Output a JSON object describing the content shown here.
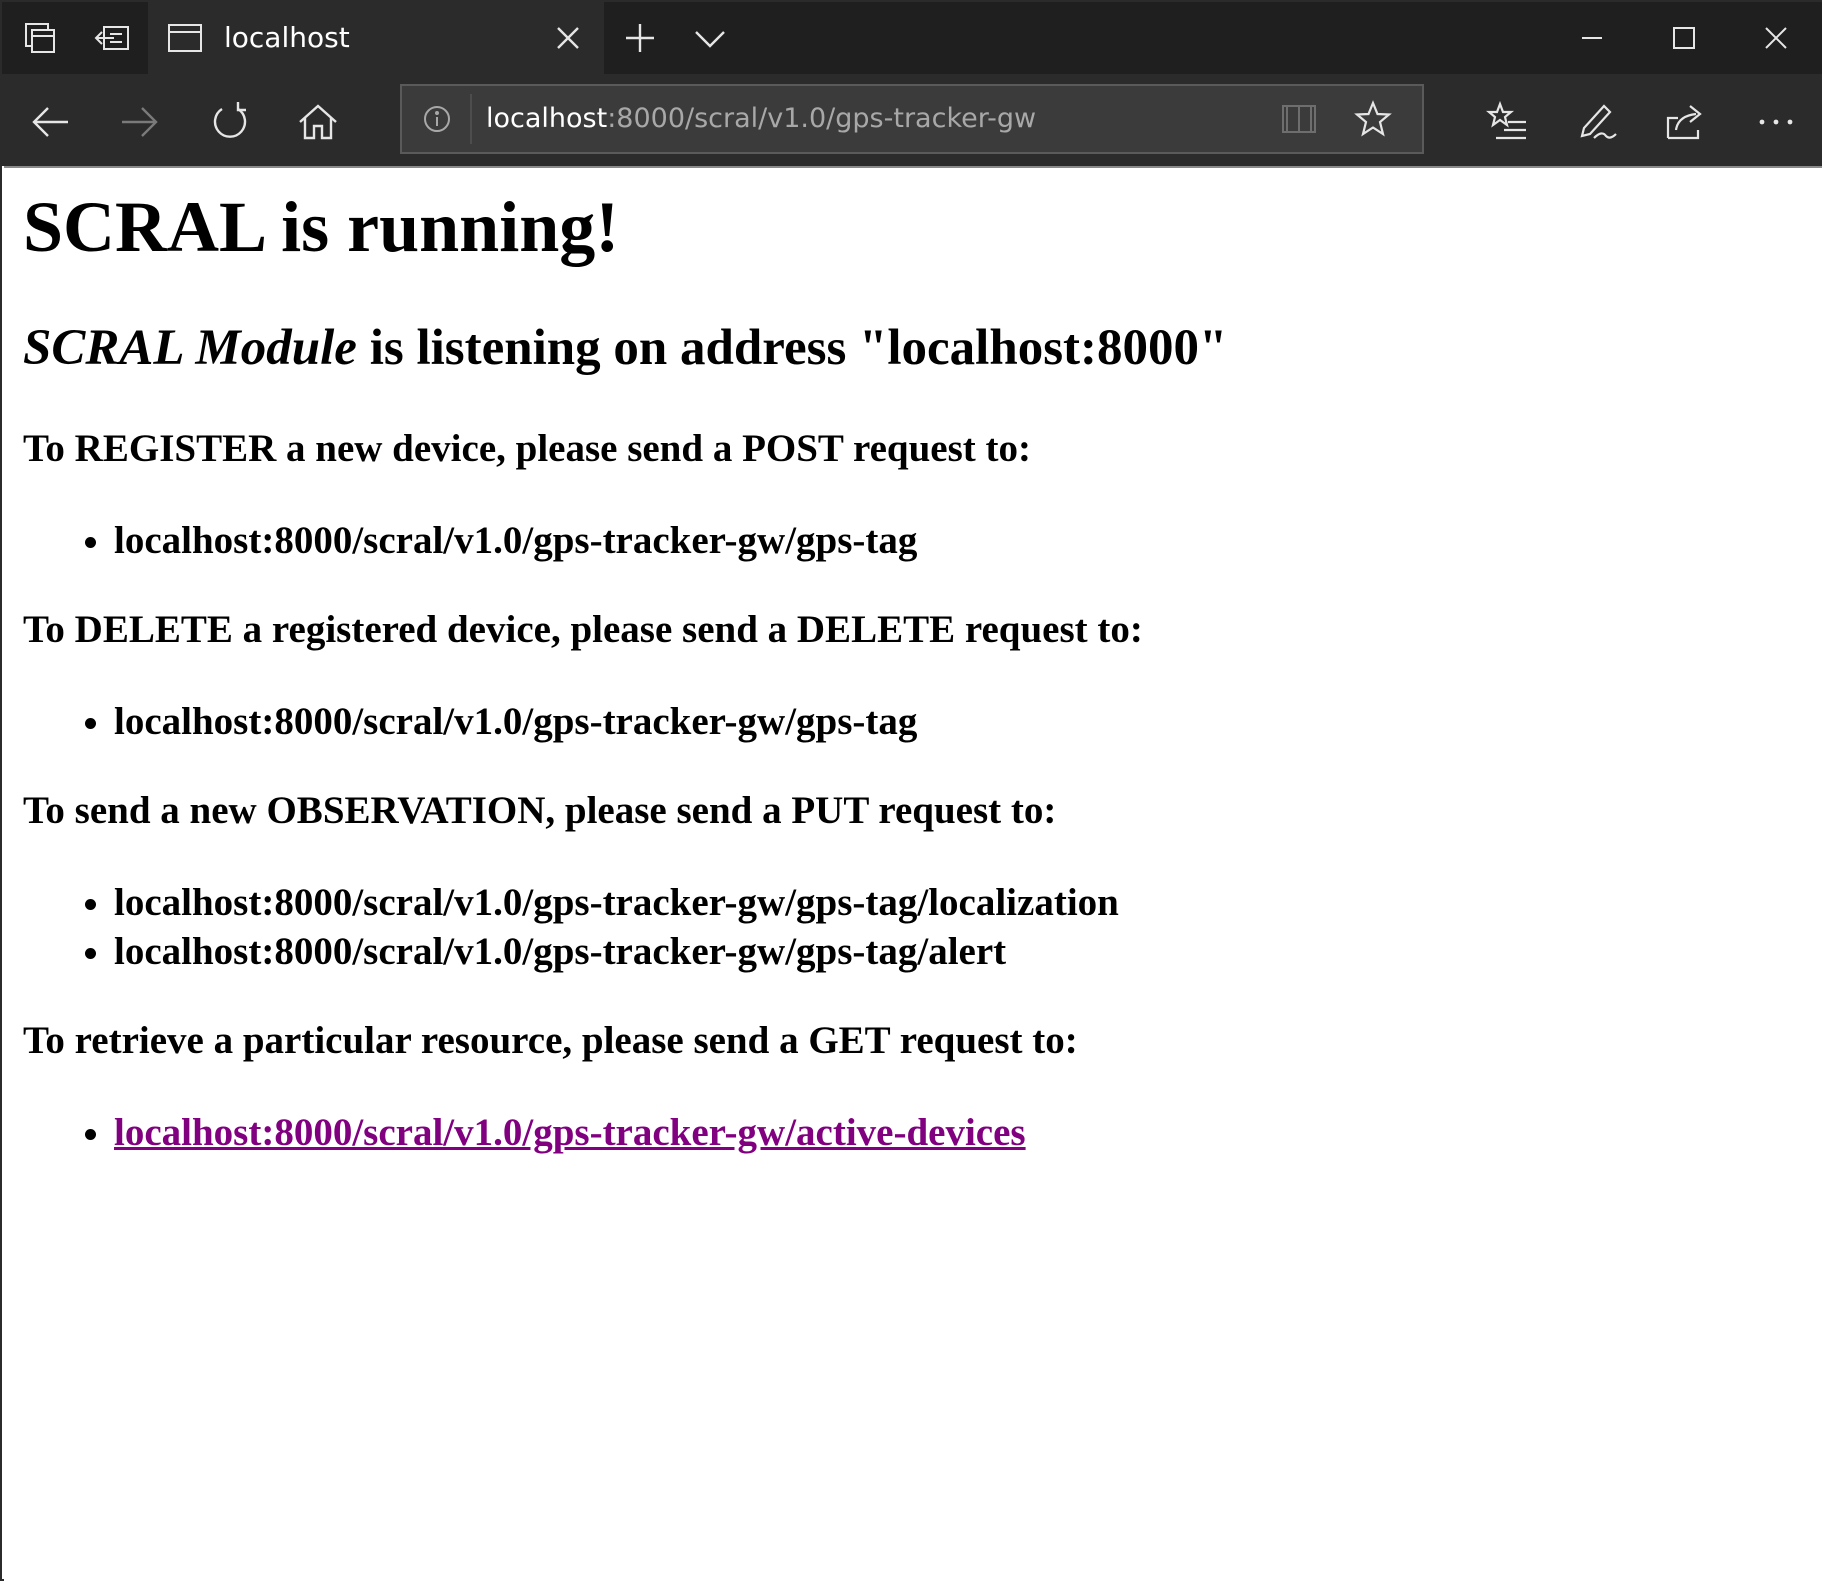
{
  "browser": {
    "tab": {
      "title": "localhost"
    },
    "address": {
      "host": "localhost",
      "path": ":8000/scral/v1.0/gps-tracker-gw"
    }
  },
  "page": {
    "title": "SCRAL is running!",
    "subtitle_em": "SCRAL Module",
    "subtitle_rest": " is listening on address \"localhost:8000\"",
    "sections": [
      {
        "heading": "To REGISTER a new device, please send a POST request to:",
        "endpoints": [
          "localhost:8000/scral/v1.0/gps-tracker-gw/gps-tag"
        ]
      },
      {
        "heading": "To DELETE a registered device, please send a DELETE request to:",
        "endpoints": [
          "localhost:8000/scral/v1.0/gps-tracker-gw/gps-tag"
        ]
      },
      {
        "heading": "To send a new OBSERVATION, please send a PUT request to:",
        "endpoints": [
          "localhost:8000/scral/v1.0/gps-tracker-gw/gps-tag/localization",
          "localhost:8000/scral/v1.0/gps-tracker-gw/gps-tag/alert"
        ]
      },
      {
        "heading": "To retrieve a particular resource, please send a GET request to:",
        "link": "localhost:8000/scral/v1.0/gps-tracker-gw/active-devices"
      }
    ]
  },
  "colors": {
    "link_visited": "#800080",
    "chrome_dark": "#1f1f1f",
    "chrome_mid": "#2b2b2b"
  }
}
